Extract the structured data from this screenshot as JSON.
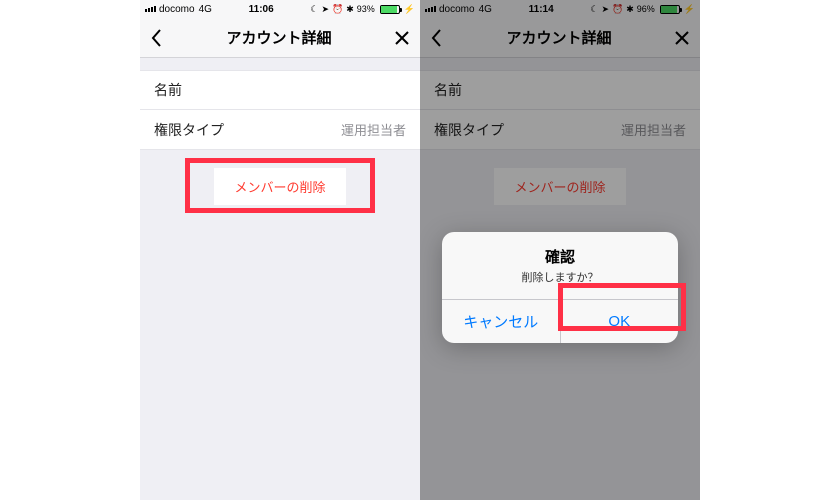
{
  "left": {
    "status": {
      "carrier": "docomo",
      "network": "4G",
      "time": "11:06",
      "battery_pct": "93%"
    },
    "nav": {
      "title": "アカウント詳細"
    },
    "rows": {
      "name_label": "名前",
      "name_value": "　　　　",
      "role_label": "権限タイプ",
      "role_value": "運用担当者"
    },
    "delete_label": "メンバーの削除"
  },
  "right": {
    "status": {
      "carrier": "docomo",
      "network": "4G",
      "time": "11:14",
      "battery_pct": "96%"
    },
    "nav": {
      "title": "アカウント詳細"
    },
    "rows": {
      "name_label": "名前",
      "name_value": "　　　　",
      "role_label": "権限タイプ",
      "role_value": "運用担当者"
    },
    "delete_label": "メンバーの削除",
    "alert": {
      "title": "確認",
      "message": "削除しますか？",
      "cancel": "キャンセル",
      "ok": "OK"
    }
  }
}
